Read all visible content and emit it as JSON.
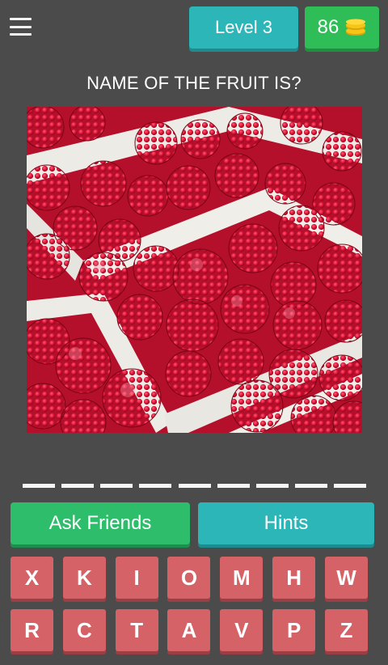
{
  "header": {
    "level_label": "Level 3",
    "coins": "86",
    "coin_icon": "coin-stack-icon",
    "menu_icon": "hamburger-menu-icon"
  },
  "question": "NAME OF THE FRUIT IS?",
  "answer_slots": 9,
  "buttons": {
    "ask_friends": "Ask Friends",
    "hints": "Hints"
  },
  "keyboard": {
    "row1": [
      "X",
      "K",
      "I",
      "O",
      "M",
      "H",
      "W"
    ],
    "row2": [
      "R",
      "C",
      "T",
      "A",
      "V",
      "P",
      "Z"
    ]
  },
  "colors": {
    "background": "#4b4b4b",
    "teal": "#2db6b8",
    "green": "#2ebd6b",
    "key": "#d46267",
    "coin": "#f5c518"
  }
}
